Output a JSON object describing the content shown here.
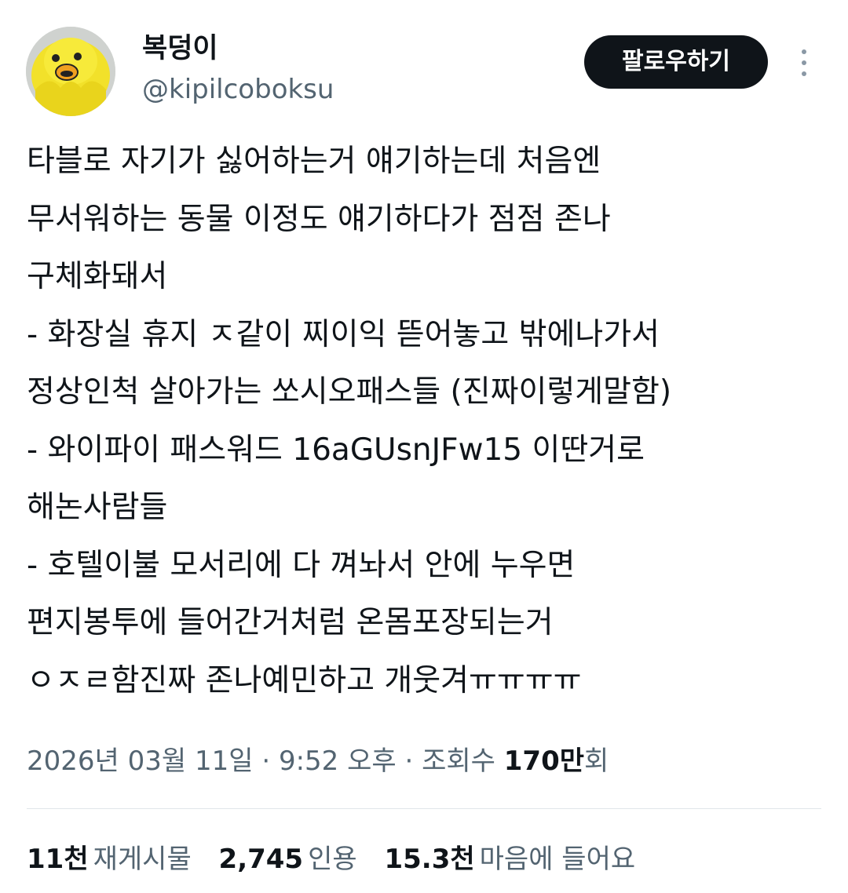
{
  "author": {
    "display_name": "복덩이",
    "handle": "@kipilcoboksu"
  },
  "follow_label": "팔로우하기",
  "tweet_lines": [
    "타블로 자기가 싫어하는거 얘기하는데 처음엔",
    "무서워하는 동물 이정도 얘기하다가 점점 존나",
    "구체화돼서",
    "- 화장실 휴지 ㅈ같이 찌이익 뜯어놓고 밖에나가서",
    "정상인척 살아가는 쏘시오패스들 (진짜이렇게말함)",
    "- 와이파이 패스워드 16aGUsnJFw15 이딴거로",
    "해논사람들",
    "- 호텔이불 모서리에 다 껴놔서 안에 누우면",
    "편지봉투에 들어간거처럼 온몸포장되는거",
    "ㅇㅈㄹ함진짜 존나예민하고 개웃겨ㅠㅠㅠㅠ"
  ],
  "meta": {
    "date": "2026년 03월 11일",
    "separator": " · ",
    "time": "9:52 오후",
    "views_label": "조회수 ",
    "views_count": "170만",
    "views_suffix": "회"
  },
  "stats": {
    "retweets": {
      "count": "11천",
      "label": "재게시물"
    },
    "quotes": {
      "count": "2,745",
      "label": "인용"
    },
    "likes": {
      "count": "15.3천",
      "label": "마음에 들어요"
    }
  },
  "colors": {
    "text_primary": "#0f1419",
    "text_secondary": "#536471",
    "follow_button_bg": "#0f1419",
    "divider": "#e1e6ea"
  },
  "icons": {
    "avatar": "yellow-chick-toy",
    "more": "more-vertical-icon"
  }
}
